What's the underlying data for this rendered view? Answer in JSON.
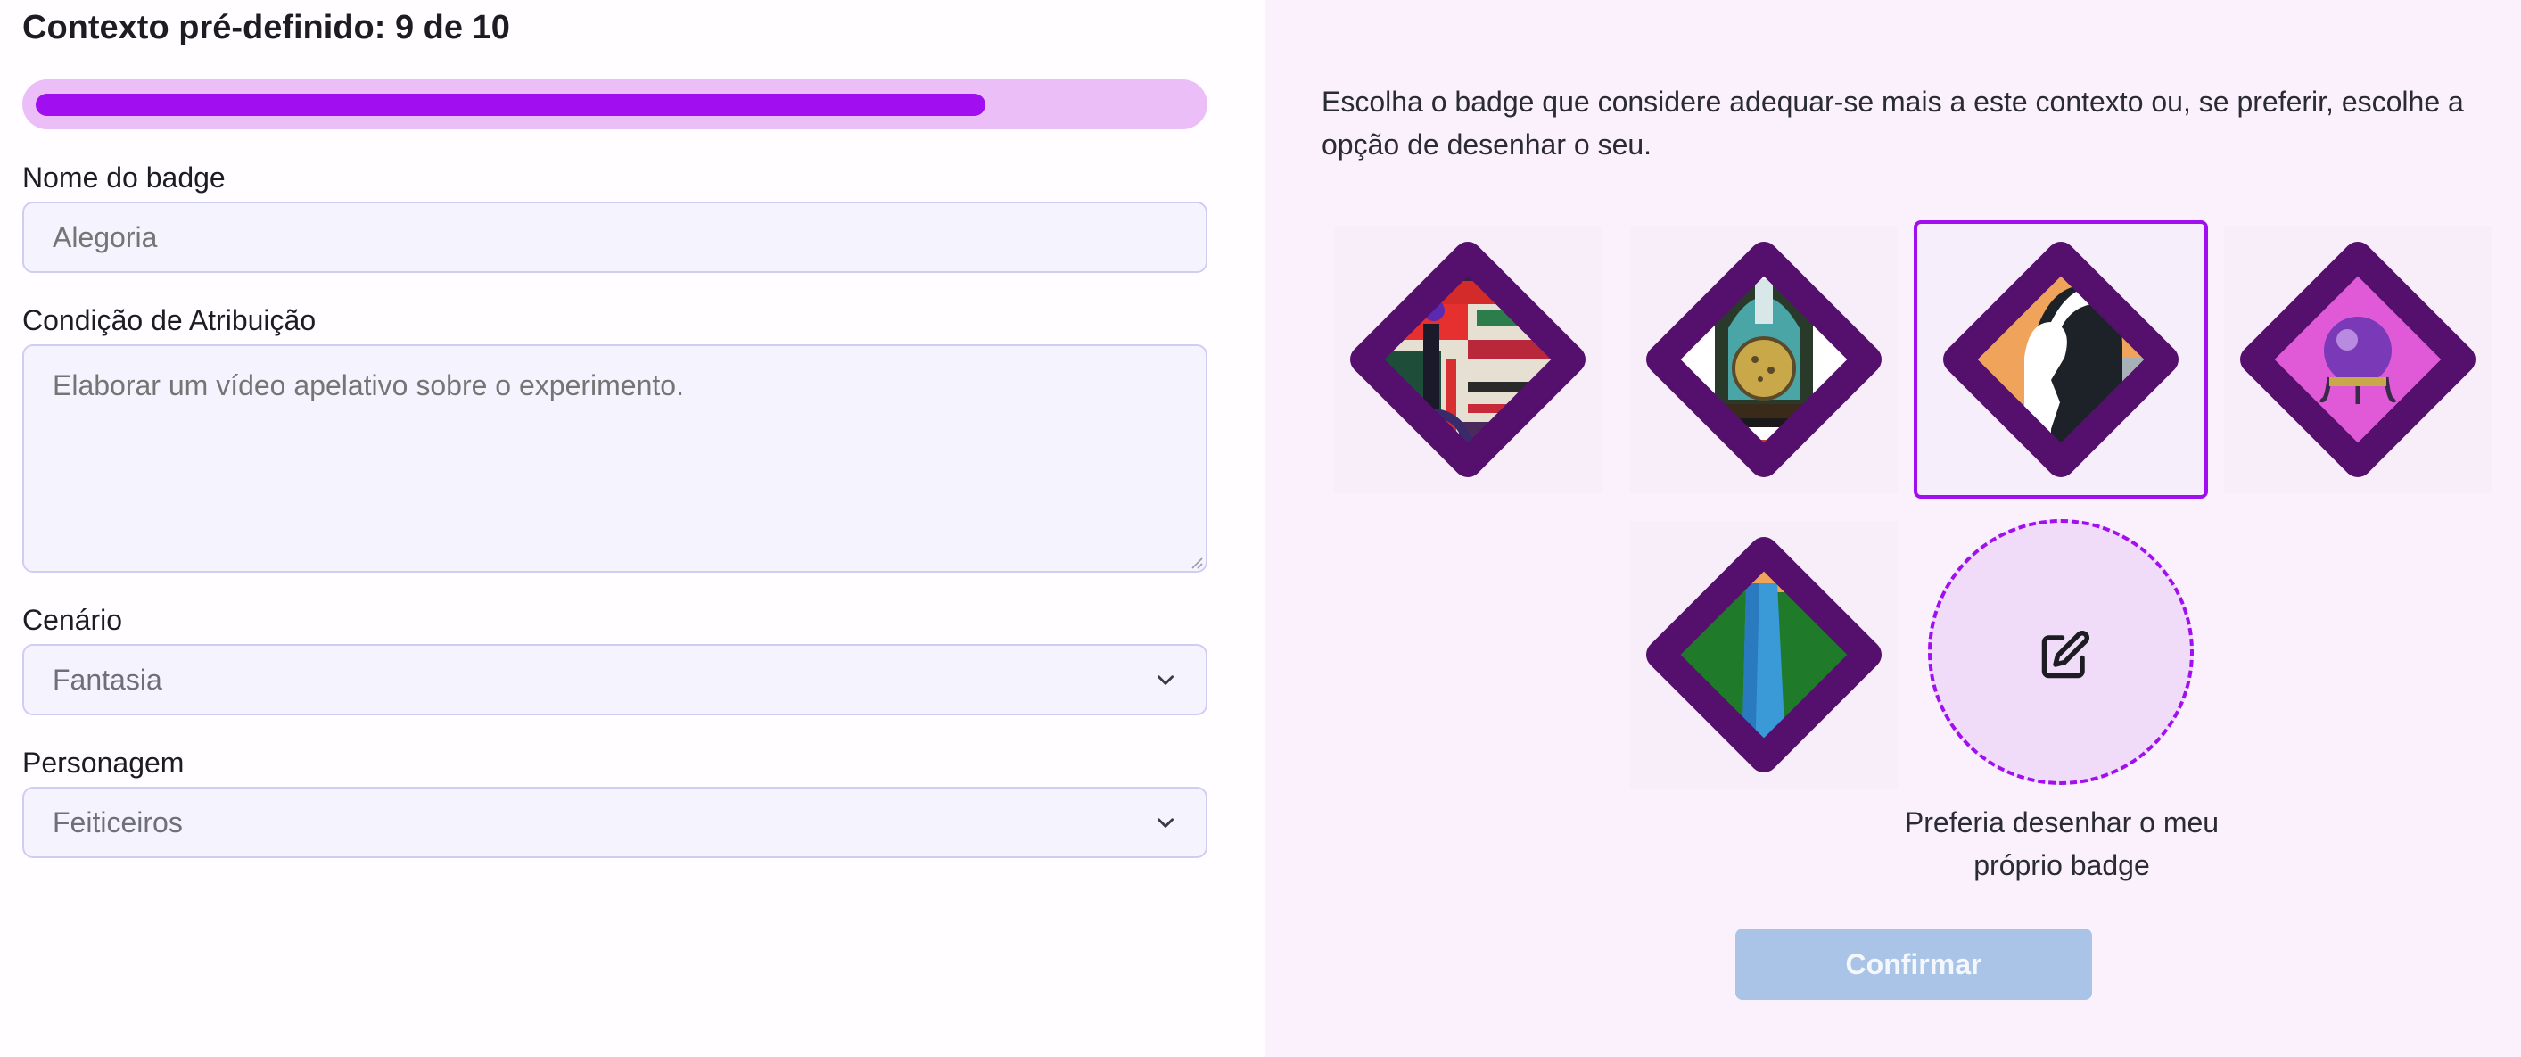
{
  "header": {
    "title": "Contexto pré-definido: 9 de 10"
  },
  "progress": {
    "value": 9,
    "max": 10,
    "fill_fraction": 0.82,
    "color": "#a10ef0",
    "track_color": "#ebbef8"
  },
  "form": {
    "name_label": "Nome do badge",
    "name_placeholder": "Alegoria",
    "condition_label": "Condição de Atribuição",
    "condition_placeholder": "Elaborar um vídeo apelativo sobre o experimento.",
    "scenario_label": "Cenário",
    "scenario_value": "Fantasia",
    "character_label": "Personagem",
    "character_value": "Feiticeiros"
  },
  "panel": {
    "description": "Escolha o badge que considere adequar-se mais a este contexto ou, se preferir, escolhe a opção de desenhar o seu.",
    "draw_label": "Preferia desenhar o meu próprio badge",
    "confirm_label": "Confirmar"
  },
  "badges": [
    {
      "id": "abstract-stripes",
      "selected": false
    },
    {
      "id": "potion-flask",
      "selected": false
    },
    {
      "id": "hooded-figure",
      "selected": true
    },
    {
      "id": "crystal-ball",
      "selected": false
    },
    {
      "id": "forest-waterfall",
      "selected": false
    }
  ],
  "icons": {
    "draw": "edit-icon",
    "select": "chevron-down-icon"
  },
  "colors": {
    "accent": "#a10ef0",
    "badge_frame": "#55106e",
    "button_disabled": "#aac4e8"
  }
}
